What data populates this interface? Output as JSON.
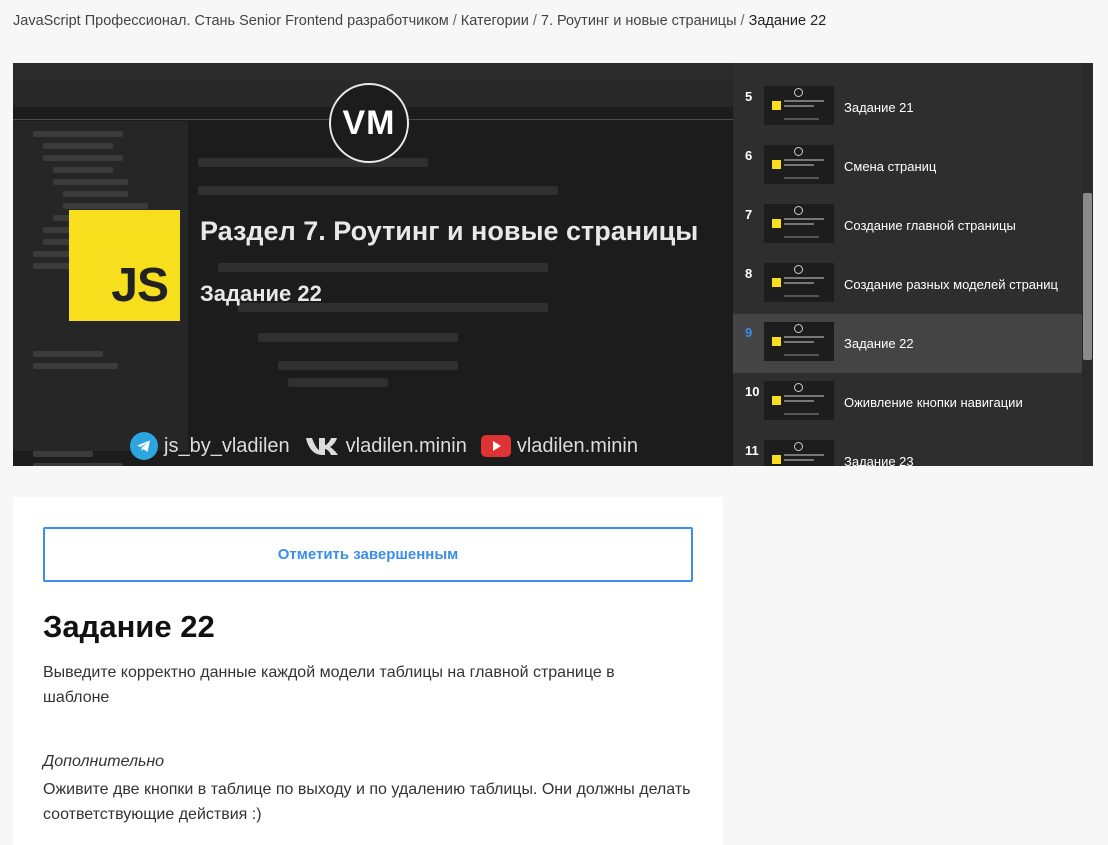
{
  "breadcrumb": {
    "items": [
      "JavaScript Профессионал. Стань Senior Frontend разработчиком",
      "Категории",
      "7. Роутинг и новые страницы"
    ],
    "current": "Задание 22",
    "separator": "/"
  },
  "video": {
    "logo": "VM",
    "badge": "JS",
    "title": "Раздел 7. Роутинг и новые страницы",
    "subtitle": "Задание 22",
    "socials": [
      {
        "icon": "telegram-icon",
        "label": "js_by_vladilen"
      },
      {
        "icon": "vk-icon",
        "label": "vladilen.minin"
      },
      {
        "icon": "youtube-icon",
        "label": "vladilen.minin"
      }
    ]
  },
  "playlist": {
    "items": [
      {
        "num": "5",
        "title": "Задание 21"
      },
      {
        "num": "6",
        "title": "Смена страниц"
      },
      {
        "num": "7",
        "title": "Создание главной страницы"
      },
      {
        "num": "8",
        "title": "Создание разных моделей страниц"
      },
      {
        "num": "9",
        "title": "Задание 22",
        "active": true
      },
      {
        "num": "10",
        "title": "Оживление кнопки навигации"
      },
      {
        "num": "11",
        "title": "Задание 23"
      }
    ]
  },
  "lesson": {
    "complete_label": "Отметить завершенным",
    "title": "Задание 22",
    "description": "Выведите корректно данные каждой модели таблицы на главной странице в шаблоне",
    "extra_label": "Дополнительно",
    "extra_text": "Оживите две кнопки в таблице по выходу и по удалению таблицы. Они должны делать соответствующие действия :)"
  },
  "colors": {
    "accent": "#3b8eea",
    "js_yellow": "#f7df1e",
    "playlist_bg": "#2e2e2e",
    "active_item_bg": "#444444"
  }
}
